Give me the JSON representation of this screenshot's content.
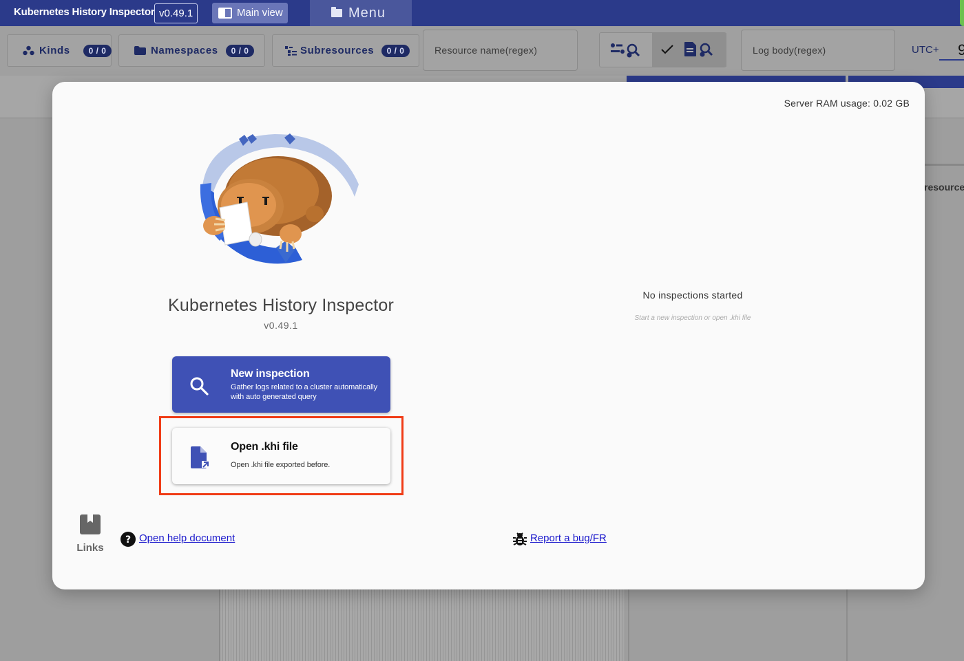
{
  "header": {
    "app_title": "Kubernetes History Inspector",
    "version": "v0.49.1",
    "main_view_label": "Main view",
    "menu_label": "Menu"
  },
  "filters": {
    "kinds": {
      "label": "Kinds",
      "count": "0 / 0"
    },
    "namespaces": {
      "label": "Namespaces",
      "count": "0 / 0"
    },
    "subresources": {
      "label": "Subresources",
      "count": "0 / 0"
    },
    "resource_name_placeholder": "Resource name(regex)",
    "log_body_placeholder": "Log body(regex)",
    "timezone_label": "UTC+",
    "timezone_value": "9"
  },
  "background": {
    "resource_header": "resource"
  },
  "dialog": {
    "ram_usage": "Server RAM usage: 0.02 GB",
    "product_title": "Kubernetes History Inspector",
    "product_version": "v0.49.1",
    "actions": {
      "new_inspection": {
        "title": "New inspection",
        "description": "Gather logs related to a cluster automatically with auto generated query"
      },
      "open_khi": {
        "title": "Open .khi file",
        "description": "Open .khi file exported before."
      }
    },
    "inspections_status": "No inspections started",
    "inspections_hint": "Start a new inspection or open .khi file",
    "links": {
      "label": "Links",
      "help": "Open help document",
      "bug_report": "Report a bug/FR"
    }
  },
  "colors": {
    "primary": "#3f51b5",
    "header": "#2b3a8a",
    "highlight": "#f03c16",
    "link": "#1a18cc"
  }
}
